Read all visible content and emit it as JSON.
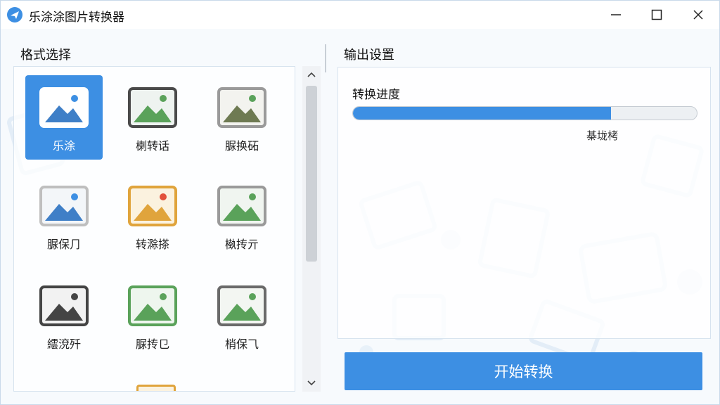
{
  "window": {
    "title": "乐涂涂图片转换器",
    "icon": "airplane-icon",
    "controls": {
      "minimize": "minimize-icon",
      "maximize": "maximize-icon",
      "close": "close-icon"
    }
  },
  "format_section": {
    "title": "格式选择",
    "selected_index": 0,
    "items": [
      {
        "label": "乐涂",
        "frame": "#ffffff",
        "sky": "#ffffff",
        "mountain": "#3f7fc7",
        "sun": "#3d8fe3"
      },
      {
        "label": "楋转话",
        "frame": "#4a4a4a",
        "sky": "#eef3f0",
        "mountain": "#5aa25a",
        "sun": "#5aa25a"
      },
      {
        "label": "脲换砳",
        "frame": "#9a9a9a",
        "sky": "#f3f3ef",
        "mountain": "#6e7a52",
        "sun": "#5aa25a"
      },
      {
        "label": "脲保⺆",
        "frame": "#bfbfbf",
        "sky": "#f3f6f9",
        "mountain": "#3f7fc7",
        "sun": "#3d8fe3"
      },
      {
        "label": "转滁搽",
        "frame": "#e0a43c",
        "sky": "#fbf2df",
        "mountain": "#e0a43c",
        "sun": "#e2513a"
      },
      {
        "label": "槸抟亓",
        "frame": "#9a9a9a",
        "sky": "#f0f5f0",
        "mountain": "#5aa25a",
        "sun": "#5aa25a"
      },
      {
        "label": "繧渷歼",
        "frame": "#444444",
        "sky": "#f2f2f2",
        "mountain": "#444444",
        "sun": "#444444"
      },
      {
        "label": "脲抟⺋",
        "frame": "#5aa25a",
        "sky": "#eef6ee",
        "mountain": "#5aa25a",
        "sun": "#5aa25a"
      },
      {
        "label": "梢保⺄",
        "frame": "#6a6a6a",
        "sky": "#f3f6f2",
        "mountain": "#5aa25a",
        "sun": "#5aa25a"
      }
    ]
  },
  "scrollbar": {
    "up": "chevron-up-icon",
    "down": "chevron-down-icon"
  },
  "output_section": {
    "title": "输出设置",
    "progress_label": "转换进度",
    "progress_value": 0.75,
    "progress_status": "棊垅栲",
    "accent": "#3d8fe3"
  },
  "start_button": {
    "label": "开始转换"
  }
}
